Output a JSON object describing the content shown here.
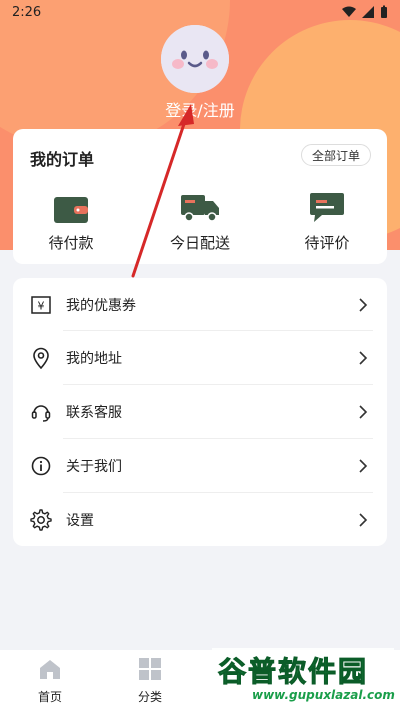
{
  "status_bar": {
    "time": "2:26"
  },
  "header": {
    "login_label": "登录/注册"
  },
  "orders": {
    "title": "我的订单",
    "all_orders_label": "全部订单",
    "items": [
      {
        "label": "待付款",
        "icon": "wallet-icon"
      },
      {
        "label": "今日配送",
        "icon": "delivery-truck-icon"
      },
      {
        "label": "待评价",
        "icon": "review-chat-icon"
      }
    ]
  },
  "menu": [
    {
      "label": "我的优惠券",
      "icon": "coupon-icon"
    },
    {
      "label": "我的地址",
      "icon": "location-pin-icon"
    },
    {
      "label": "联系客服",
      "icon": "headset-icon"
    },
    {
      "label": "关于我们",
      "icon": "info-icon"
    },
    {
      "label": "设置",
      "icon": "gear-icon"
    }
  ],
  "tabbar": [
    {
      "label": "首页",
      "icon": "home-icon"
    },
    {
      "label": "分类",
      "icon": "grid-icon"
    }
  ],
  "watermark": {
    "title": "谷普软件园",
    "url": "www.gupuxlazal.com"
  },
  "colors": {
    "header_bg": "#fb8f6c",
    "accent_dark": "#3d5a45",
    "accent_red": "#e8725c",
    "annotation_arrow": "#d62828"
  }
}
